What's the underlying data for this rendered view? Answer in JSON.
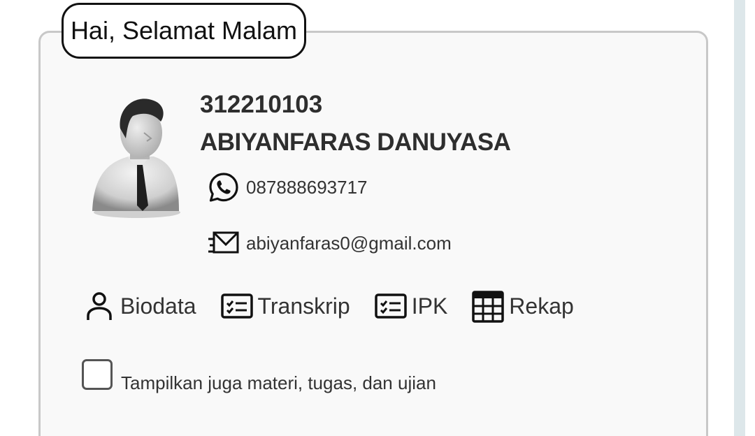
{
  "greeting": "Hai, Selamat Malam",
  "student": {
    "id": "312210103",
    "name": "ABIYANFARAS DANUYASA",
    "phone": "087888693717",
    "email": "abiyanfaras0@gmail.com"
  },
  "menu": [
    {
      "label": "Biodata",
      "icon": "person-icon"
    },
    {
      "label": "Transkrip",
      "icon": "checklist-icon"
    },
    {
      "label": "IPK",
      "icon": "checklist-icon"
    },
    {
      "label": "Rekap",
      "icon": "table-grid-icon"
    }
  ],
  "options": {
    "show_materials_label": "Tampilkan juga materi, tugas, dan ujian",
    "show_materials_checked": false
  }
}
